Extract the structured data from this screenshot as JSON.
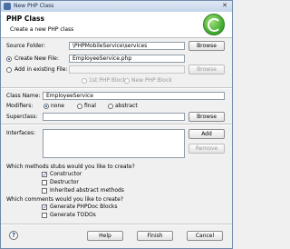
{
  "window": {
    "title": "New PHP Class"
  },
  "banner": {
    "title": "PHP Class",
    "subtitle": "Create a new PHP class"
  },
  "source_folder": {
    "label": "Source Folder:",
    "value": "\\PHPMobileService\\services",
    "browse": "Browse"
  },
  "location": {
    "create_new_label": "Create New File:",
    "create_new_value": "EmployeeService.php",
    "add_existing_label": "Add in existing File:",
    "add_existing_value": "",
    "browse": "Browse",
    "block_first": "1st PHP Block",
    "block_new": "New PHP Block"
  },
  "class_name": {
    "label": "Class Name:",
    "value": "EmployeeService"
  },
  "modifiers": {
    "label": "Modifiers:",
    "none": "none",
    "final": "final",
    "abstract": "abstract"
  },
  "superclass": {
    "label": "Superclass:",
    "value": "",
    "browse": "Browse"
  },
  "interfaces": {
    "label": "Interfaces:",
    "add": "Add",
    "remove": "Remove"
  },
  "stubs": {
    "question": "Which methods stubs would you like to create?",
    "constructor": "Constructor",
    "destructor": "Destructor",
    "inherited": "Inherited abstract methods"
  },
  "comments": {
    "question": "Which comments would you like to create?",
    "phpdoc": "Generate PHPDoc Blocks",
    "todos": "Generate TODOs"
  },
  "footer": {
    "help_glyph": "?",
    "help": "Help",
    "finish": "Finish",
    "cancel": "Cancel"
  }
}
